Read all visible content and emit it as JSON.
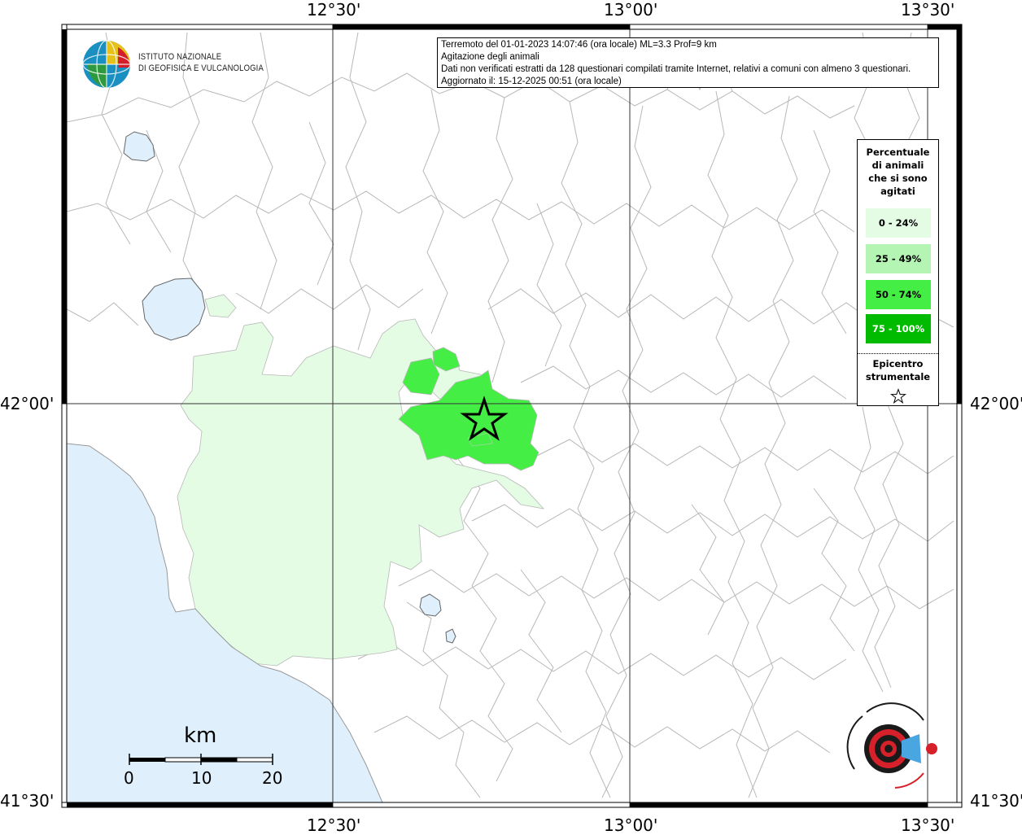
{
  "coordinates": {
    "lon_labels": [
      "12°30'",
      "13°00'",
      "13°30'"
    ],
    "lat_labels": [
      "42°00'",
      "41°30'"
    ]
  },
  "info": {
    "line1": "Terremoto del 01-01-2023 14:07:46 (ora locale) ML=3.3 Prof=9 km",
    "line2": "Agitazione degli animali",
    "line3": "Dati non verificati estratti da 128 questionari compilati tramite Internet, relativi a comuni con almeno 3 questionari.",
    "line4": "Aggiornato il: 15-12-2025 00:51 (ora locale)"
  },
  "institute": {
    "line1": "ISTITUTO NAZIONALE",
    "line2": "DI GEOFISICA E VULCANOLOGIA"
  },
  "legend": {
    "title": [
      "Percentuale",
      "di animali",
      "che si sono",
      "agitati"
    ],
    "items": [
      {
        "label": "0 - 24%",
        "color": "#e3fce3"
      },
      {
        "label": "25 - 49%",
        "color": "#b4f5b4"
      },
      {
        "label": "50 - 74%",
        "color": "#44ee44"
      },
      {
        "label": "75 - 100%",
        "color": "#00bb00"
      }
    ],
    "epicenter": [
      "Epicentro",
      "strumentale"
    ]
  },
  "scale": {
    "title": "km",
    "labels": [
      "0",
      "10",
      "20"
    ]
  },
  "colors": {
    "sea": "#dff0fc",
    "lake": "#dff0fc",
    "border": "#b8b8b8",
    "grid": "#333333"
  }
}
